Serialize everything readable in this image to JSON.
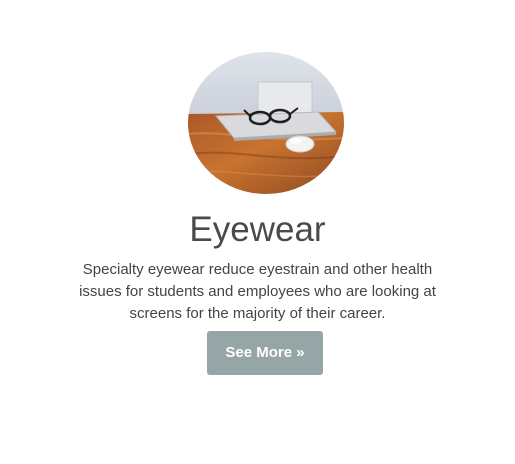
{
  "feature": {
    "image_alt_icon": "laptop-glasses-mouse-photo",
    "title": "Eyewear",
    "description": "Specialty eyewear reduce eyestrain and other health issues for students and employees who are looking at screens for the majority of their career.",
    "button_label": "See More »"
  },
  "colors": {
    "button_bg": "#96a6a6",
    "title_text": "#4a4a4a",
    "body_text": "#444444"
  }
}
